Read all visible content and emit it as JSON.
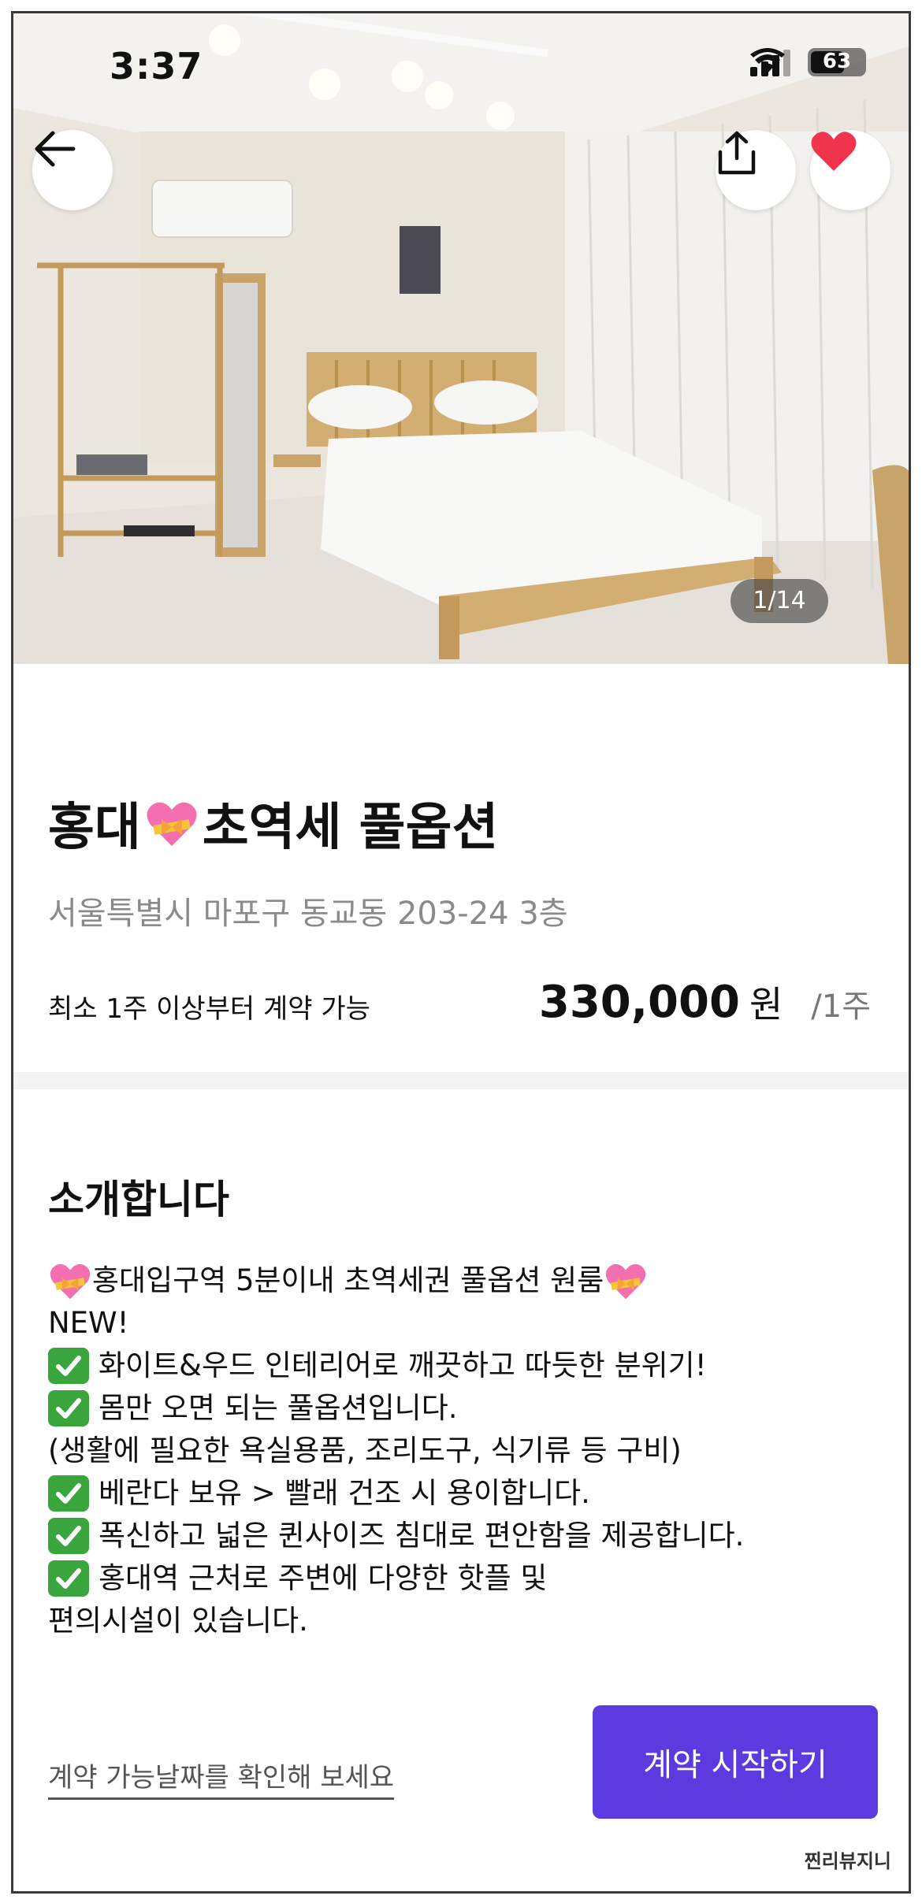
{
  "status_bar": {
    "time": "3:37",
    "battery": "63"
  },
  "hero": {
    "photo_counter": "1/14"
  },
  "listing": {
    "title_part1": "홍대",
    "title_part2": "초역세 풀옵션",
    "address": "서울특별시 마포구 동교동 203-24 3층",
    "min_contract": "최소 1주 이상부터 계약 가능",
    "price_amount": "330,000",
    "price_unit": "원",
    "price_period": "/1주"
  },
  "intro": {
    "heading": "소개합니다",
    "lines": [
      "홍대입구역 5분이내 초역세권 풀옵션 원룸",
      "NEW!",
      "화이트&우드 인테리어로 깨끗하고 따듯한 분위기!",
      "몸만 오면 되는 풀옵션입니다.",
      "(생활에 필요한 욕실용품, 조리도구, 식기류 등 구비)",
      "베란다 보유 > 빨래 건조 시 용이합니다.",
      "폭신하고 넓은 퀸사이즈 침대로 편안함을 제공합니다.",
      "홍대역 근처로 주변에 다양한 핫플 및",
      "편의시설이 있습니다."
    ]
  },
  "footer": {
    "date_link": "계약 가능날짜를 확인해 보세요",
    "start_button": "계약 시작하기",
    "watermark": "찐리뷰지니"
  },
  "colors": {
    "accent": "#5b3be0",
    "heart": "#f0344e",
    "check": "#3aa53d"
  }
}
